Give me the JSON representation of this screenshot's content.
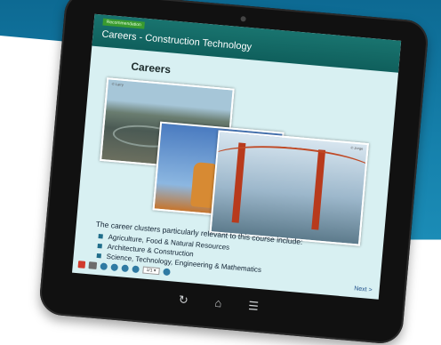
{
  "lesson": {
    "tag": "Recommendation",
    "title": "Careers - Construction Technology",
    "heading": "Careers"
  },
  "photos": {
    "p1_caption": "© Larry",
    "p3_caption": "© Jorge"
  },
  "content": {
    "intro": "The career clusters particularly relevant to this course include:",
    "items": [
      "Agriculture, Food & Natural Resources",
      "Architecture & Construction",
      "Science, Technology, Engineering & Mathematics"
    ]
  },
  "player": {
    "page_select": "1/1 ▾",
    "next": "Next >"
  },
  "device_nav": {
    "back_icon": "refresh-icon",
    "home_icon": "home-icon",
    "menu_icon": "list-icon"
  }
}
